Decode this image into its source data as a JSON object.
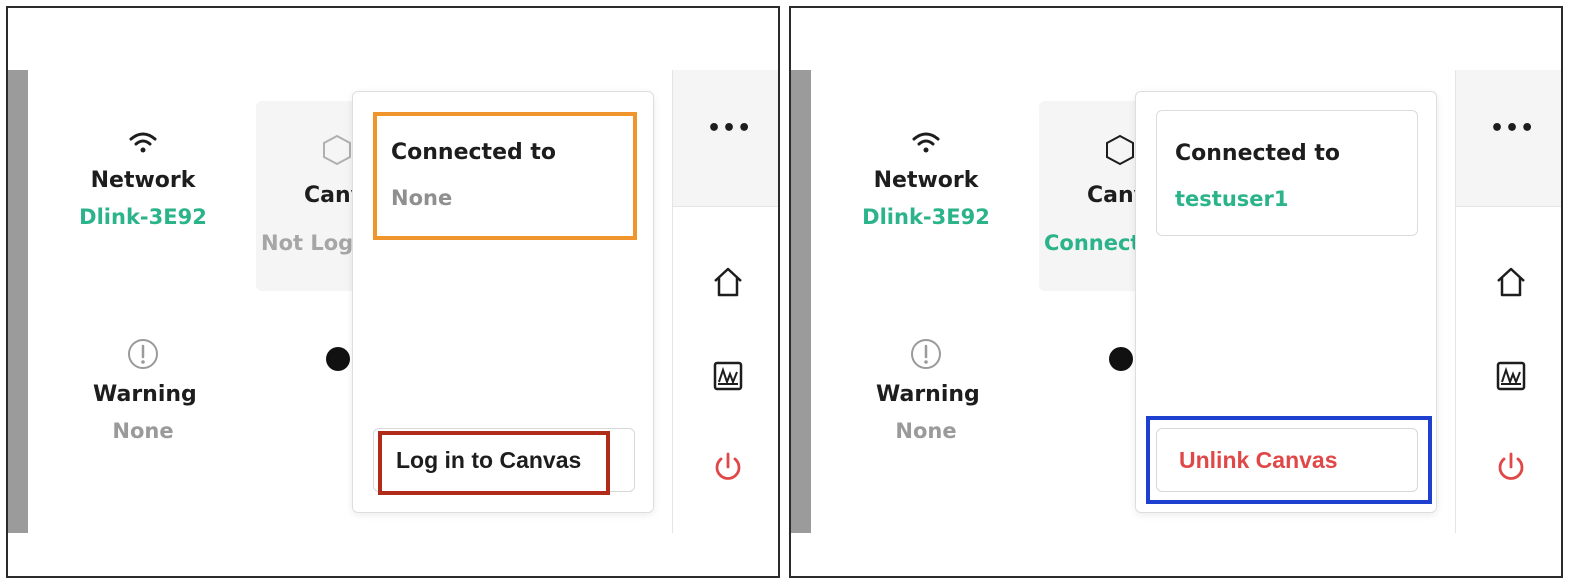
{
  "left": {
    "network": {
      "title": "Network",
      "value": "Dlink-3E92"
    },
    "warning": {
      "title": "Warning",
      "value": "None"
    },
    "canvas_card": {
      "title": "Canvas",
      "value": "Not Logged In"
    },
    "popover": {
      "label": "Connected to",
      "value": "None",
      "button": "Log in to Canvas"
    }
  },
  "right": {
    "network": {
      "title": "Network",
      "value": "Dlink-3E92"
    },
    "warning": {
      "title": "Warning",
      "value": "None"
    },
    "canvas_card": {
      "title": "Canvas",
      "value": "Connected"
    },
    "popover": {
      "label": "Connected to",
      "value": "testuser1",
      "button": "Unlink Canvas"
    }
  },
  "menu_glyph": "•••",
  "icons": [
    "wifi-icon",
    "warning-icon",
    "canvas-hex-icon",
    "more-icon",
    "home-icon",
    "chart-icon",
    "power-icon"
  ],
  "colors": {
    "green": "#2bb38a",
    "gray_text": "#9a9a9a",
    "red": "#e04848",
    "highlight_orange": "#f0952b",
    "highlight_red": "#b02b1a",
    "highlight_blue": "#1f3fd1"
  }
}
